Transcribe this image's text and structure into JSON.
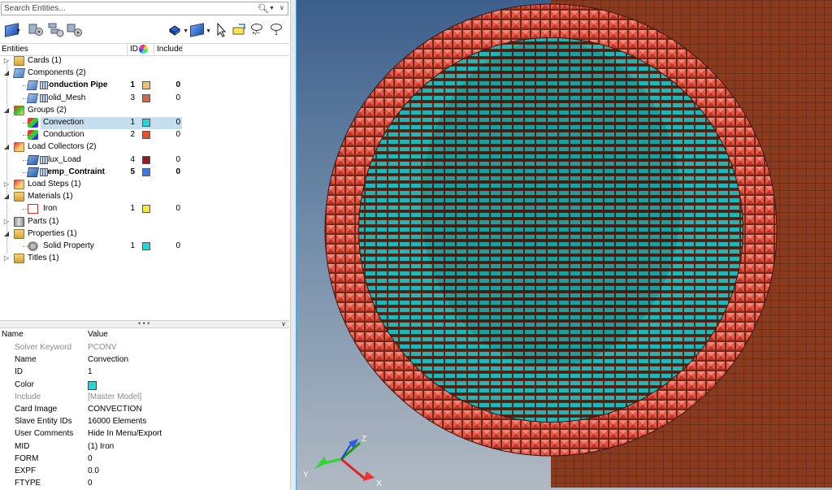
{
  "search": {
    "placeholder": "Search Entities..."
  },
  "colors": {
    "selection": "#c6deee",
    "accent_blue": "#3fa6e6"
  },
  "toolbar": {
    "icons": [
      "component-cube-icon",
      "dropdown-arrow-icon",
      "filter-gear-icon",
      "expand-gear-icon",
      "collapse-gear-icon",
      "display-cube-icon",
      "select-cube-icon",
      "cursor-icon",
      "isolate-icon",
      "show-hide-eye-icon",
      "show-one-eye-icon"
    ]
  },
  "tree_header": {
    "entities": "Entities",
    "id": "ID",
    "include": "Include"
  },
  "tree": [
    {
      "label": "Cards (1)",
      "level": 0,
      "icon": "cards-icon"
    },
    {
      "label": "Components (2)",
      "level": 0,
      "icon": "components-icon"
    },
    {
      "label": "Conduction Pipe",
      "level": 1,
      "id": "1",
      "color": "#e8c37a",
      "include": "0",
      "bold": true,
      "icon": "component-icon"
    },
    {
      "label": "Solid_Mesh",
      "level": 1,
      "id": "3",
      "color": "#c2704d",
      "include": "0",
      "icon": "component-icon"
    },
    {
      "label": "Groups (2)",
      "level": 0,
      "icon": "groups-icon"
    },
    {
      "label": "Convection",
      "level": 1,
      "id": "1",
      "color": "#27d3d6",
      "include": "0",
      "selected": true,
      "icon": "group-icon"
    },
    {
      "label": "Conduction",
      "level": 1,
      "id": "2",
      "color": "#e5512e",
      "include": "0",
      "icon": "group-icon"
    },
    {
      "label": "Load Collectors (2)",
      "level": 0,
      "icon": "load-collectors-icon"
    },
    {
      "label": "Flux_Load",
      "level": 1,
      "id": "4",
      "color": "#8a1e22",
      "include": "0",
      "icon": "load-collector-icon"
    },
    {
      "label": "Temp_Contraint",
      "level": 1,
      "id": "5",
      "color": "#3f79e0",
      "include": "0",
      "bold": true,
      "icon": "load-collector-icon"
    },
    {
      "label": "Load Steps (1)",
      "level": 0,
      "icon": "load-steps-icon"
    },
    {
      "label": "Materials (1)",
      "level": 0,
      "icon": "materials-icon"
    },
    {
      "label": "Iron",
      "level": 1,
      "id": "1",
      "color": "#f2ea3a",
      "include": "0",
      "icon": "material-icon"
    },
    {
      "label": "Parts (1)",
      "level": 0,
      "icon": "parts-icon"
    },
    {
      "label": "Properties (1)",
      "level": 0,
      "icon": "properties-icon"
    },
    {
      "label": "Solid Property",
      "level": 1,
      "id": "1",
      "color": "#27d3d6",
      "include": "0",
      "icon": "property-icon"
    },
    {
      "label": "Titles (1)",
      "level": 0,
      "icon": "titles-icon"
    }
  ],
  "props_header": {
    "name": "Name",
    "value": "Value"
  },
  "properties": [
    {
      "name": "Solver Keyword",
      "value": "PCONV",
      "grey": true
    },
    {
      "name": "Name",
      "value": "Convection"
    },
    {
      "name": "ID",
      "value": "1"
    },
    {
      "name": "Color",
      "value": "",
      "swatch": "#27d3d6"
    },
    {
      "name": "Include",
      "value": "[Master Model]",
      "grey": true
    },
    {
      "name": "Card Image",
      "value": "CONVECTION"
    },
    {
      "name": "Slave Entity IDs",
      "value": "16000 Elements"
    },
    {
      "name": "User Comments",
      "value": "Hide In Menu/Export"
    },
    {
      "name": "MID",
      "value": "(1) Iron"
    },
    {
      "name": "FORM",
      "value": "0"
    },
    {
      "name": "EXPF",
      "value": "0.0"
    },
    {
      "name": "FTYPE",
      "value": "0"
    }
  ],
  "viewport": {
    "triad": {
      "x": "X",
      "y": "Y",
      "z": "Z"
    },
    "colors": {
      "pipe": "#8a3b1f",
      "ring_tile": "#e9574a",
      "inner_mesh": "#1fb7b7",
      "background_top": "#3d5f8c"
    }
  }
}
